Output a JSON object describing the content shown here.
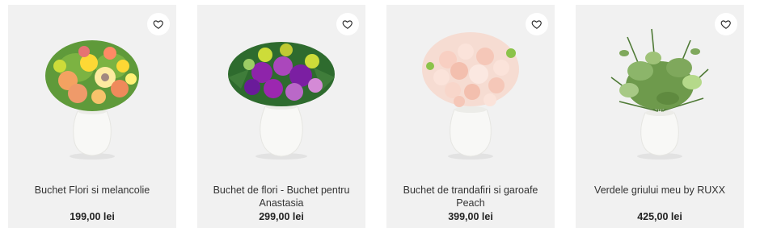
{
  "products": [
    {
      "name": "Buchet Flori si melancolie",
      "price": "199,00 lei",
      "image_icon": "mixed-bouquet-vase-image"
    },
    {
      "name": "Buchet de flori - Buchet pentru Anastasia",
      "price": "299,00 lei",
      "image_icon": "purple-bouquet-vase-image"
    },
    {
      "name": "Buchet de trandafiri si garoafe Peach",
      "price": "399,00 lei",
      "image_icon": "peach-roses-vase-image"
    },
    {
      "name": "Verdele griului meu by RUXX",
      "price": "425,00 lei",
      "image_icon": "greenery-bouquet-vase-image"
    }
  ],
  "favorite_icon": "heart-icon",
  "colors": {
    "card_bg": "#f1f1f1",
    "text": "#333333",
    "price": "#222222"
  }
}
